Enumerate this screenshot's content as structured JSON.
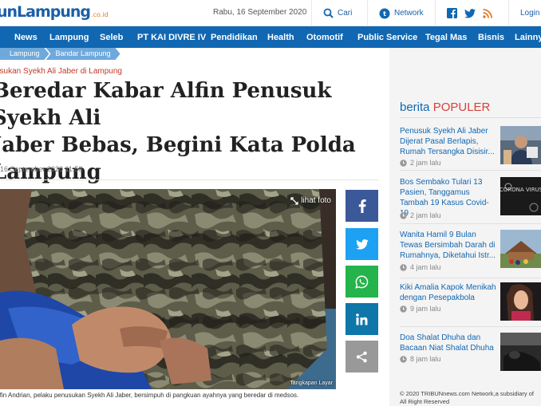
{
  "header": {
    "logo_main": "unLampung",
    "logo_suffix": ".co.id",
    "date": "Rabu, 16 September 2020",
    "cari": "Cari",
    "network": "Network",
    "login": "Login"
  },
  "nav": {
    "items": [
      "News",
      "Lampung",
      "Seleb",
      "PT KAI DIVRE IV",
      "Pendidikan",
      "Health",
      "Otomotif",
      "Public Service",
      "Tegal Mas",
      "Bisnis",
      "Lainnya"
    ]
  },
  "breadcrumb": [
    "Lampung",
    "Bandar Lampung"
  ],
  "article": {
    "kicker": "usukan Syekh Ali Jaber di Lampung",
    "title_lines": [
      "Beredar Kabar Alfin Penusuk Syekh Ali",
      "Jaber Bebas, Begini Kata Polda",
      "Lampung"
    ],
    "date": "16 September 2020 11:58",
    "lihat_foto": "lihat foto",
    "photo_credit": "Tangkapan Layar",
    "caption": "lfin Andrian, pelaku penusukan Syekh Ali Jaber, bersimpuh di pangkuan ayahnya yang beredar di medsos."
  },
  "share": [
    "facebook-icon",
    "twitter-icon",
    "whatsapp-icon",
    "linkedin-icon",
    "share-icon"
  ],
  "colors": {
    "brand": "#1167b1",
    "facebook": "#3b5998",
    "twitter": "#1da1f2",
    "whatsapp": "#25b34b",
    "linkedin": "#0e76a8",
    "share": "#999999",
    "popular_accent": "#d6403a"
  },
  "popular": {
    "label_a": "berita",
    "label_b": "POPULER",
    "items": [
      {
        "title": "Penusuk Syekh Ali Jaber Dijerat Pasal Berlapis, Rumah Tersangka Disisir...",
        "time": "2 jam lalu"
      },
      {
        "title": "Bos Sembako Tulari 13 Pasien, Tanggamus Tambah 19 Kasus Covid-19",
        "time": "2 jam lalu"
      },
      {
        "title": "Wanita Hamil 9 Bulan Tewas Bersimbah Darah di Rumahnya, Diketahui Istr...",
        "time": "4 jam lalu"
      },
      {
        "title": "Kiki Amalia Kapok Menikah dengan Pesepakbola",
        "time": "9 jam lalu"
      },
      {
        "title": "Doa Shalat Dhuha dan Bacaan Niat Shalat Dhuha",
        "time": "8 jam lalu"
      }
    ],
    "thumb2_text": "CORONA VIRUS"
  },
  "footer": {
    "copyright": "© 2020 TRIBUNnews.com Network,a subsidiary of",
    "rights": "All Right Reserved"
  }
}
